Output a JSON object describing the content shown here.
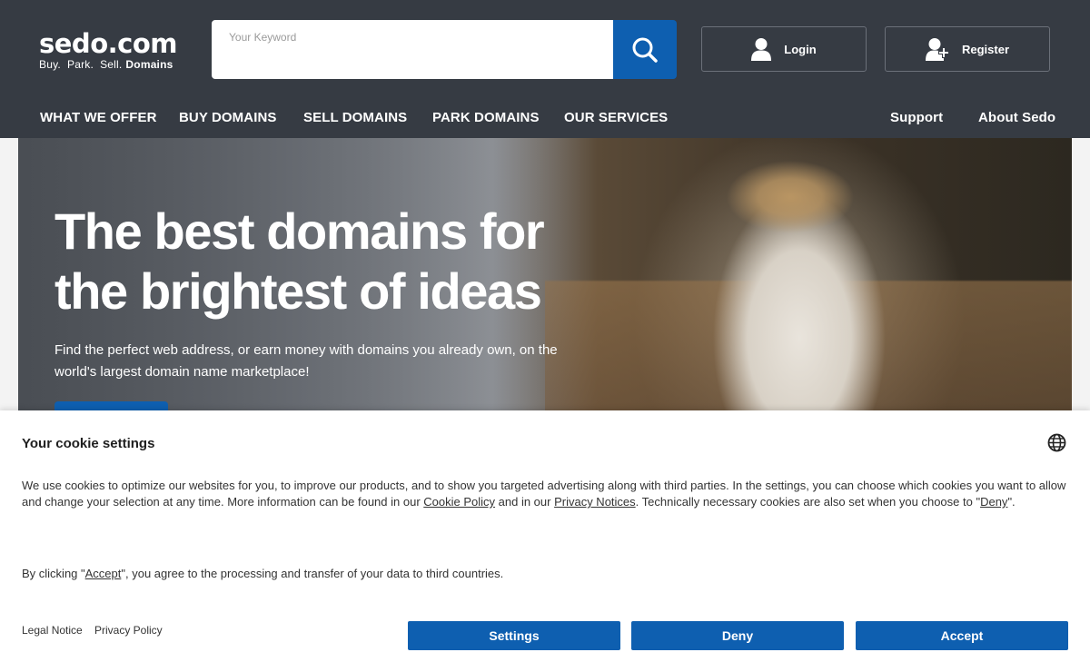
{
  "header": {
    "logo_main": "sedo.com",
    "logo_tagline": "Buy.  Park.  Sell.",
    "logo_tagline_bold": "Domains",
    "search_placeholder": "Your Keyword",
    "login_label": "Login",
    "register_label": "Register"
  },
  "nav": {
    "items": [
      "WHAT WE OFFER",
      "BUY DOMAINS",
      "SELL DOMAINS",
      "PARK DOMAINS",
      "OUR SERVICES"
    ],
    "support": "Support",
    "about": "About Sedo"
  },
  "hero": {
    "title": "The best domains for the brightest of ideas",
    "subtitle": "Find the perfect web address, or earn money with domains you already own, on the world's largest domain name marketplace!"
  },
  "cookie": {
    "title": "Your cookie settings",
    "text_part1": "We use cookies to optimize our websites for you, to improve our products, and to show you targeted advertising along with third parties. In the settings, you can choose which cookies you want to allow and change your selection at any time. More information can be found in our ",
    "cookie_policy_link": "Cookie Policy",
    "text_part2": " and in our ",
    "privacy_notices_link": "Privacy Notices",
    "text_part3": ". Technically necessary cookies are also set when you choose to \"",
    "deny_link": "Deny",
    "text_part4": "\".",
    "consent_part1": "By clicking \"",
    "accept_link": "Accept",
    "consent_part2": "\", you agree to the processing and transfer of your data to third countries.",
    "legal_notice": "Legal Notice",
    "privacy_policy": "Privacy Policy",
    "settings_button": "Settings",
    "deny_button": "Deny",
    "accept_button": "Accept"
  },
  "colors": {
    "header_bg": "#363b43",
    "brand_blue": "#0e5fb0"
  }
}
